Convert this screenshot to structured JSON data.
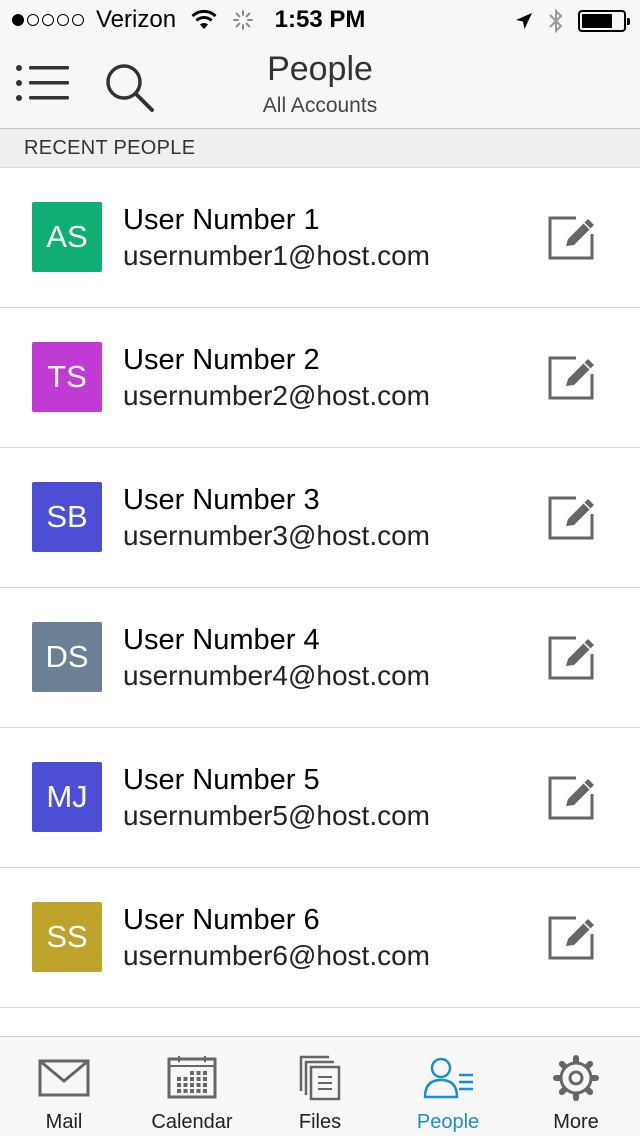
{
  "status_bar": {
    "carrier": "Verizon",
    "time": "1:53 PM",
    "signal_filled": 1,
    "signal_total": 5,
    "battery_level": 0.75
  },
  "nav": {
    "title": "People",
    "subtitle": "All Accounts",
    "menu_icon": "menu-list-icon",
    "search_icon": "search-icon"
  },
  "section": {
    "label": "RECENT PEOPLE"
  },
  "people": [
    {
      "initials": "AS",
      "name": "User Number 1",
      "email": "usernumber1@host.com",
      "color": "#0fae73"
    },
    {
      "initials": "TS",
      "name": "User Number 2",
      "email": "usernumber2@host.com",
      "color": "#c03bd3"
    },
    {
      "initials": "SB",
      "name": "User Number 3",
      "email": "usernumber3@host.com",
      "color": "#4c4fd6"
    },
    {
      "initials": "DS",
      "name": "User Number 4",
      "email": "usernumber4@host.com",
      "color": "#6b8095"
    },
    {
      "initials": "MJ",
      "name": "User Number 5",
      "email": "usernumber5@host.com",
      "color": "#4c4fd6"
    },
    {
      "initials": "SS",
      "name": "User Number 6",
      "email": "usernumber6@host.com",
      "color": "#bda22c"
    }
  ],
  "tabs": [
    {
      "label": "Mail",
      "icon": "mail-icon",
      "active": false
    },
    {
      "label": "Calendar",
      "icon": "calendar-icon",
      "active": false
    },
    {
      "label": "Files",
      "icon": "files-icon",
      "active": false
    },
    {
      "label": "People",
      "icon": "people-icon",
      "active": true
    },
    {
      "label": "More",
      "icon": "gear-icon",
      "active": false
    }
  ],
  "colors": {
    "accent": "#1a8ed1",
    "icon_gray": "#666666"
  }
}
